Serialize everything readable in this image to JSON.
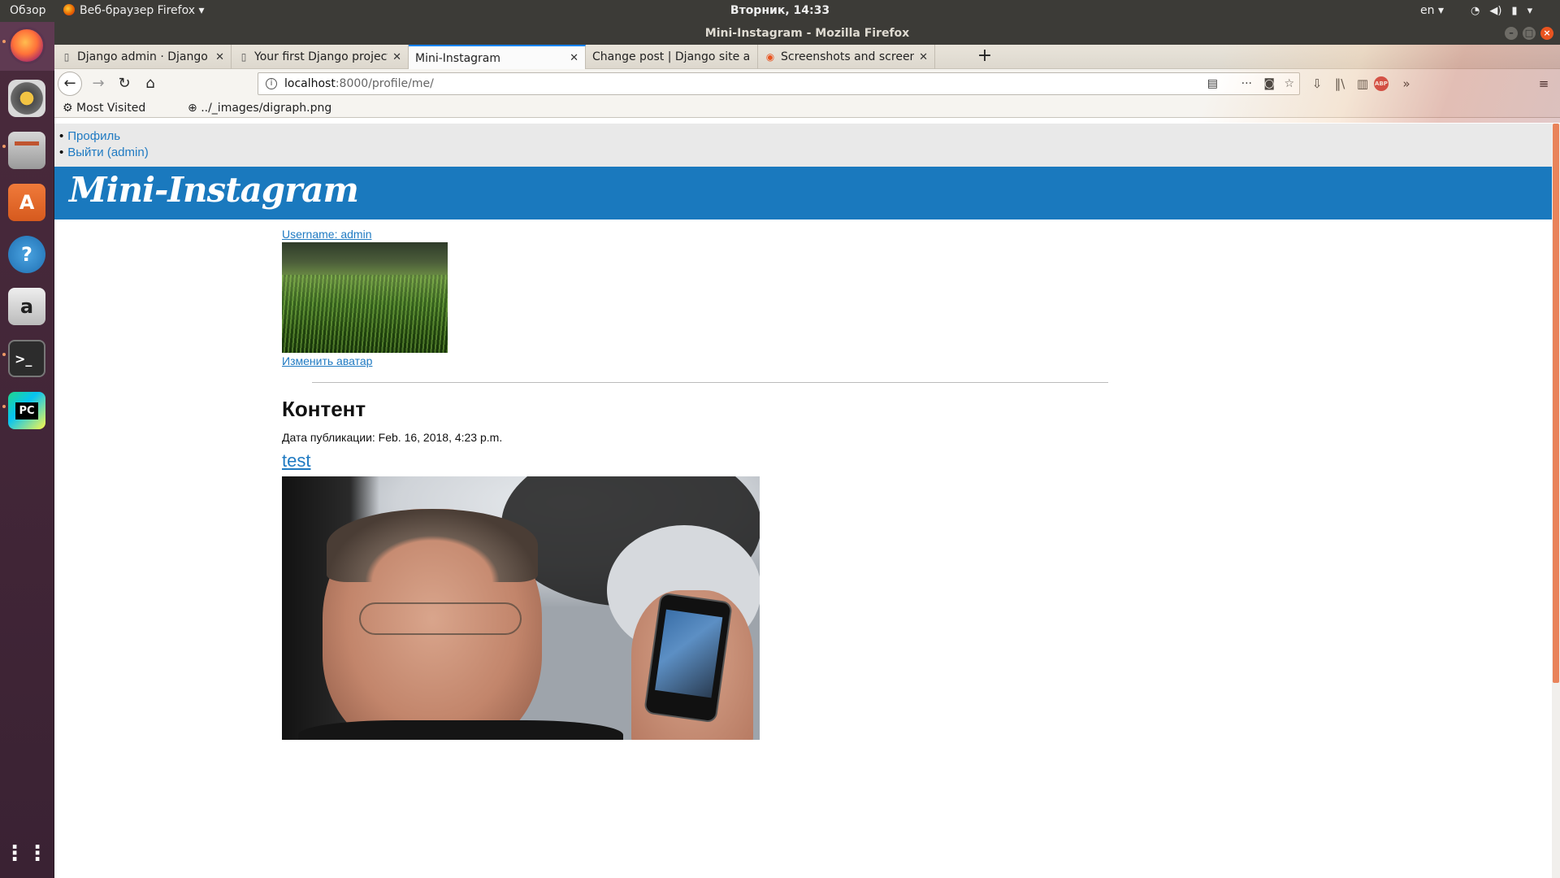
{
  "topbar": {
    "activities": "Обзор",
    "app_menu": "Веб-браузер Firefox",
    "clock": "Вторник, 14:33",
    "lang": "en"
  },
  "window": {
    "title": "Mini-Instagram - Mozilla Firefox"
  },
  "tabs": [
    {
      "label": "Django admin · Django G",
      "icon": "book-icon",
      "active": false
    },
    {
      "label": "Your first Django project",
      "icon": "book-icon",
      "active": false
    },
    {
      "label": "Mini-Instagram",
      "icon": "",
      "active": true
    },
    {
      "label": "Change post | Django site ad",
      "icon": "",
      "active": false
    },
    {
      "label": "Screenshots and screenc",
      "icon": "ubuntu-icon",
      "active": false
    }
  ],
  "urlbar": {
    "host": "localhost",
    "rest": ":8000/profile/me/"
  },
  "bookmarks": {
    "most_visited": "Most Visited",
    "digraph": "../_images/digraph.png"
  },
  "nav_menu": {
    "profile": "Профиль",
    "logout": "Выйти (admin)"
  },
  "site": {
    "title": "Mini-Instagram"
  },
  "profile": {
    "username": "Username: admin",
    "change_avatar": "Изменить аватар"
  },
  "content": {
    "section_title": "Контент",
    "pub_date": "Дата публикации: Feb. 16, 2018, 4:23 p.m.",
    "post_title": "test"
  },
  "colors": {
    "link": "#1f7ac2",
    "header": "#1a79be",
    "ubuntu_orange": "#e95420"
  }
}
